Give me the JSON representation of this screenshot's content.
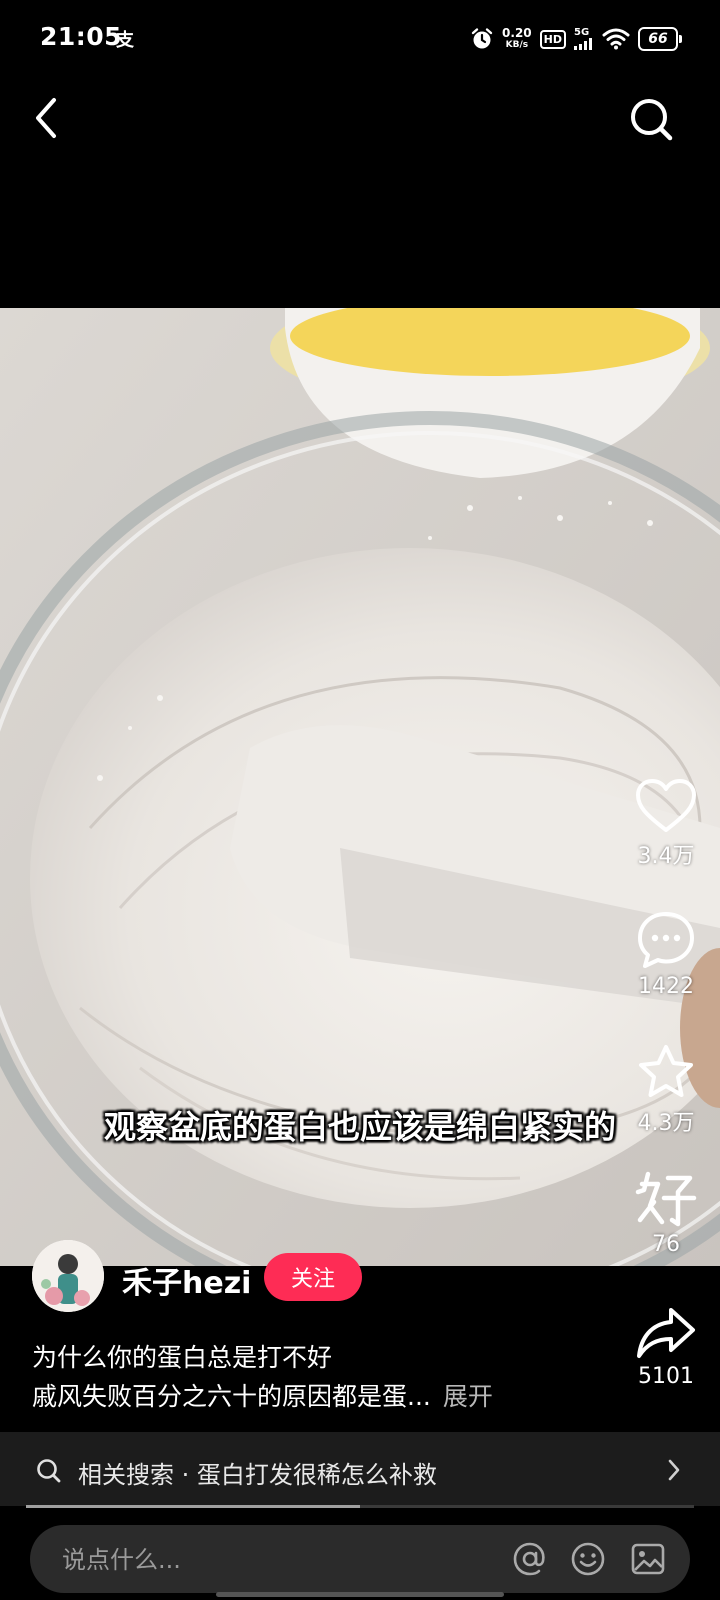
{
  "status_bar": {
    "time": "21:05",
    "alipay_glyph": "支",
    "speed_value": "0.20",
    "speed_unit": "KB/s",
    "hd": "HD",
    "network": "5G",
    "battery": "66"
  },
  "nav": {
    "back_icon": "chevron-left-icon",
    "search_icon": "search-icon"
  },
  "video": {
    "subtitle": "观察盆底的蛋白也应该是绵白紧实的"
  },
  "actions": {
    "likes": "3.4万",
    "comments": "1422",
    "favorites": "4.3万",
    "tips": "76",
    "shares": "5101"
  },
  "author": {
    "name": "禾子hezi",
    "follow_label": "关注"
  },
  "description": {
    "title": "为什么你的蛋白总是打不好",
    "line": "戚风失败百分之六十的原因都是蛋...",
    "expand": "展开"
  },
  "related_search": {
    "text": "相关搜索 · 蛋白打发很稀怎么补救"
  },
  "playback": {
    "progress_fraction": 0.5
  },
  "comment_input": {
    "placeholder": "说点什么..."
  },
  "colors": {
    "accent": "#fe2c55",
    "background": "#000000",
    "bar": "#1c1c1c",
    "input": "#2b2b2b"
  }
}
